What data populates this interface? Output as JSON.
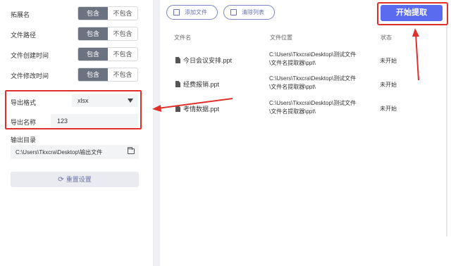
{
  "options": [
    {
      "label": "拓展名",
      "on": "包含",
      "off": "不包含"
    },
    {
      "label": "文件路径",
      "on": "包含",
      "off": "不包含"
    },
    {
      "label": "文件创建时间",
      "on": "包含",
      "off": "不包含"
    },
    {
      "label": "文件修改时间",
      "on": "包含",
      "off": "不包含"
    }
  ],
  "export": {
    "format_label": "导出格式",
    "format_value": "xlsx",
    "name_label": "导出名称",
    "name_value": "123"
  },
  "output": {
    "label": "输出目录",
    "path": "C:\\Users\\Tkxcra\\Desktop\\输出文件"
  },
  "reset_label": "重置设置",
  "toolbar": {
    "add_file": "添加文件",
    "clear_list": "清除列表",
    "start": "开始提取"
  },
  "table": {
    "headers": [
      "文件名",
      "文件位置",
      "状态"
    ],
    "rows": [
      {
        "name": "今日会议安排.ppt",
        "path1": "C:\\Users\\Tkxcra\\Desktop\\测试文件",
        "path2": "\\文件名提取器\\ppt\\",
        "status": "未开始"
      },
      {
        "name": "经费报销.ppt",
        "path1": "C:\\Users\\Tkxcra\\Desktop\\测试文件",
        "path2": "\\文件名提取器\\ppt\\",
        "status": "未开始"
      },
      {
        "name": "考情数据.ppt",
        "path1": "C:\\Users\\Tkxcra\\Desktop\\测试文件",
        "path2": "\\文件名提取器\\ppt\\",
        "status": "未开始"
      }
    ]
  },
  "colors": {
    "accent": "#5b6bf0",
    "highlight": "#e0302a",
    "toggle_on": "#6b7280"
  }
}
